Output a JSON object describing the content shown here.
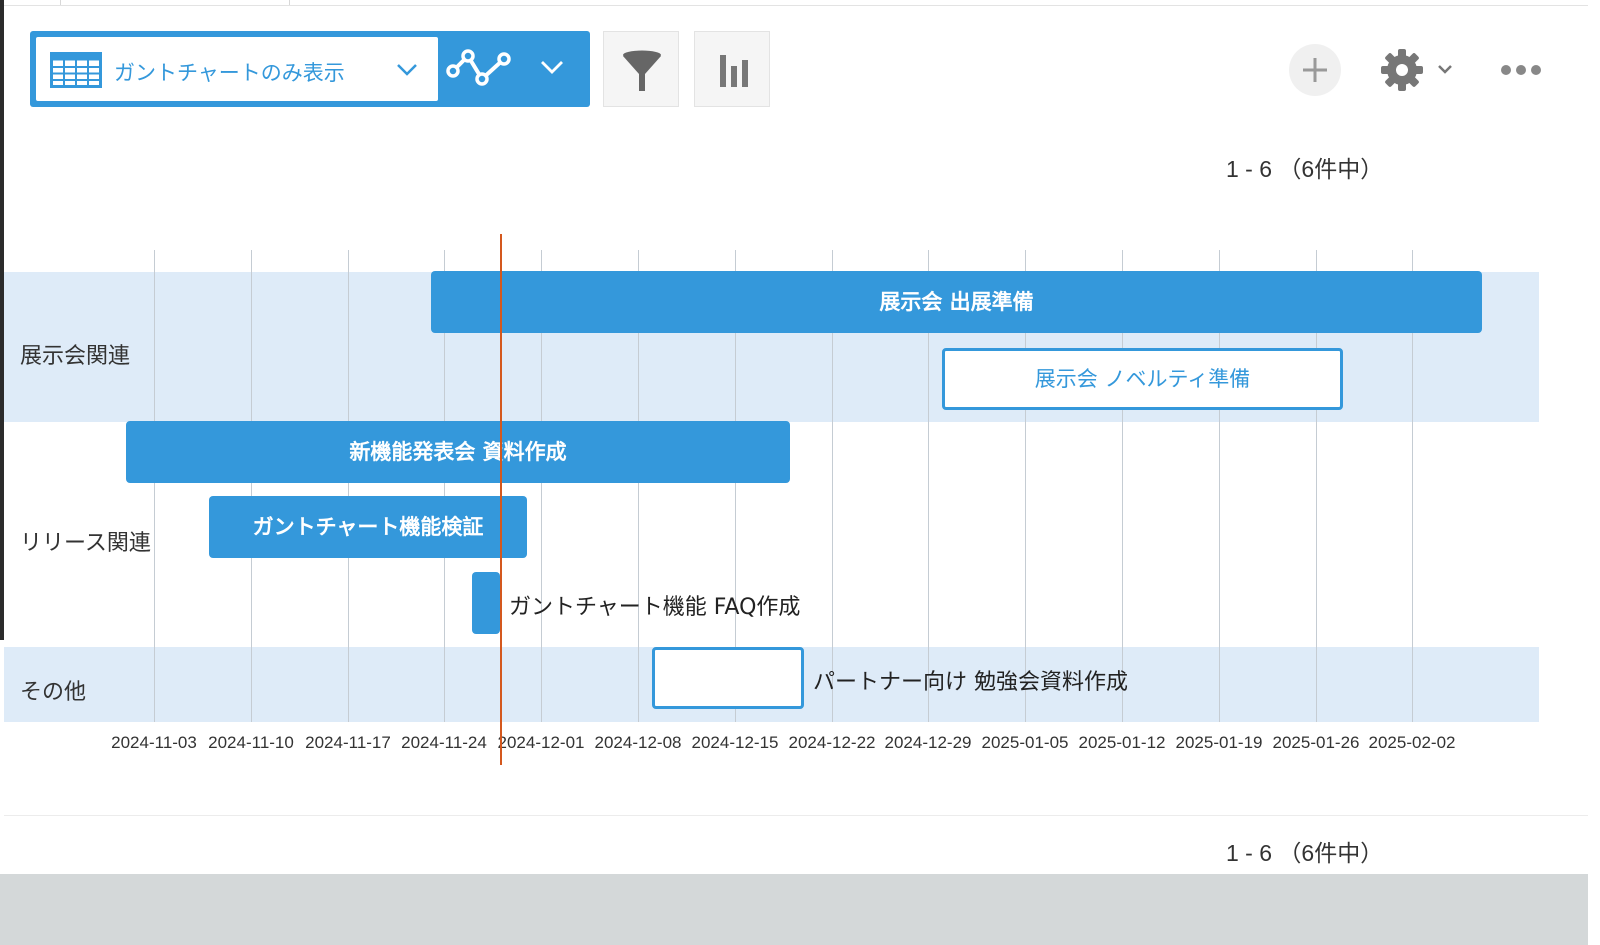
{
  "toolbar": {
    "view_label": "ガントチャートのみ表示"
  },
  "pager": {
    "top": "1 - 6 （6件中）",
    "bottom": "1 - 6 （6件中）"
  },
  "gantt": {
    "groups": [
      {
        "name": "展示会関連"
      },
      {
        "name": "リリース関連"
      },
      {
        "name": "その他"
      }
    ],
    "tasks": [
      {
        "name": "展示会 出展準備",
        "group": "展示会関連",
        "style": "filled",
        "start": "2024-11-23",
        "end": "2025-02-07"
      },
      {
        "name": "展示会 ノベルティ準備",
        "group": "展示会関連",
        "style": "outline",
        "start": "2024-12-30",
        "end": "2025-01-28"
      },
      {
        "name": "新機能発表会 資料作成",
        "group": "リリース関連",
        "style": "filled",
        "start": "2024-11-01",
        "end": "2024-12-19"
      },
      {
        "name": "ガントチャート機能検証",
        "group": "リリース関連",
        "style": "filled",
        "start": "2024-11-07",
        "end": "2024-11-30"
      },
      {
        "name": "ガントチャート機能 FAQ作成",
        "group": "リリース関連",
        "style": "filled",
        "start": "2024-11-26",
        "end": "2024-11-28"
      },
      {
        "name": "パートナー向け 勉強会資料作成",
        "group": "その他",
        "style": "outline",
        "start": "2024-12-09",
        "end": "2024-12-20"
      }
    ],
    "ticks": [
      "2024-11-03",
      "2024-11-10",
      "2024-11-17",
      "2024-11-24",
      "2024-12-01",
      "2024-12-08",
      "2024-12-15",
      "2024-12-22",
      "2024-12-29",
      "2025-01-05",
      "2025-01-12",
      "2025-01-19",
      "2025-01-26",
      "2025-02-02"
    ],
    "today": "2024-11-28",
    "colors": {
      "bar": "#3498db",
      "band": "#deebf8",
      "today_line": "#d4581e"
    }
  }
}
